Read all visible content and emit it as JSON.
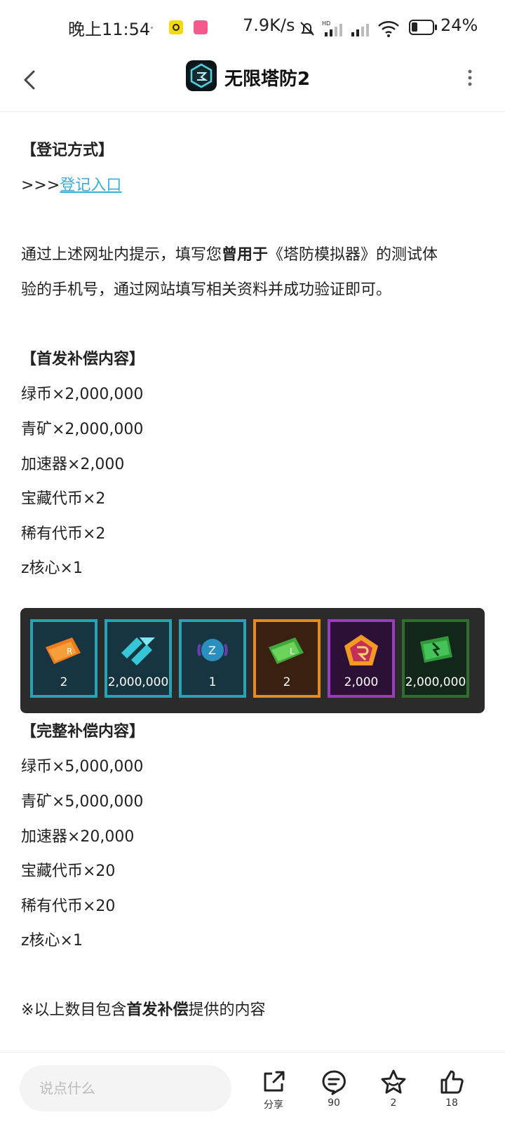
{
  "status": {
    "time": "晚上11:54",
    "net_speed": "7.9K/s",
    "battery": "24%"
  },
  "header": {
    "title": "无限塔防2"
  },
  "article": {
    "reg_heading": "【登记方式】",
    "link_prefix": ">>>",
    "link_text": "登记入口",
    "desc_1a": "通过上述网址内提示，填写您",
    "desc_1b": "曾用于",
    "desc_1c": "《塔防模拟器》的测试体",
    "desc_2": "验的手机号，通过网站填写相关资料并成功验证即可。",
    "first_heading": "【首发补偿内容】",
    "first_items": [
      "绿币×2,000,000",
      "青矿×2,000,000",
      "加速器×2,000",
      "宝藏代币×2",
      "稀有代币×2",
      "z核心×1"
    ],
    "full_heading": "【完整补偿内容】",
    "full_items": [
      "绿币×5,000,000",
      "青矿×5,000,000",
      "加速器×20,000",
      "宝藏代币×20",
      "稀有代币×20",
      "z核心×1"
    ],
    "note_a": "※以上数目包含",
    "note_b": "首发补偿",
    "note_c": "提供的内容"
  },
  "rewards": [
    {
      "icon": "rare-ticket-icon",
      "value": "2"
    },
    {
      "icon": "cyan-ore-icon",
      "value": "2,000,000"
    },
    {
      "icon": "z-core-icon",
      "value": "1"
    },
    {
      "icon": "treasure-ticket-icon",
      "value": "2"
    },
    {
      "icon": "accelerator-icon",
      "value": "2,000"
    },
    {
      "icon": "green-coin-icon",
      "value": "2,000,000"
    }
  ],
  "bottom": {
    "placeholder": "说点什么",
    "share_label": "分享",
    "comment_count": "90",
    "star_count": "2",
    "like_count": "18"
  },
  "colors": {
    "link": "#3aaed8",
    "banner_bg": "#2b2b2b"
  }
}
